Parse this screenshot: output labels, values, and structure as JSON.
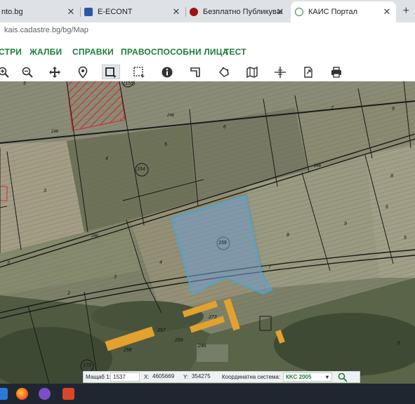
{
  "browser": {
    "tabs": [
      {
        "title": "nto.bg"
      },
      {
        "title": "E-ECONT"
      },
      {
        "title": "Безплатно Публикуване на Об"
      },
      {
        "title": "КАИС Портал"
      }
    ],
    "url": "kais.cadastre.bg/bg/Map"
  },
  "nav": {
    "items": [
      "СТРИ",
      "ЖАЛБИ",
      "СПРАВКИ",
      "ПРАВОСПОСОБНИ ЛИЦА",
      "ТЕСТ"
    ]
  },
  "toolbar": {
    "tools": [
      "zoom-in-icon",
      "zoom-out-icon",
      "pan-icon",
      "locate-pin-icon",
      "select-rectangle-icon",
      "select-area-icon",
      "info-icon",
      "measure-icon",
      "draw-icon",
      "map-layers-icon",
      "crosshair-icon",
      "export-icon",
      "print-icon"
    ],
    "selected": "select-rectangle-icon"
  },
  "map": {
    "plots": [
      {
        "label": "5"
      },
      {
        "label": "(155)"
      },
      {
        "label": "3"
      },
      {
        "label": "4"
      },
      {
        "label": "5"
      },
      {
        "label": "154"
      },
      {
        "label": "6"
      },
      {
        "label": "7"
      },
      {
        "label": "8"
      },
      {
        "label": "9"
      },
      {
        "label": "8"
      },
      {
        "label": "9"
      },
      {
        "label": "6"
      },
      {
        "label": "3"
      },
      {
        "label": "4"
      },
      {
        "label": "2"
      },
      {
        "label": "155"
      },
      {
        "label": "7"
      },
      {
        "label": "3"
      },
      {
        "label": "273"
      },
      {
        "label": "257"
      },
      {
        "label": "258"
      },
      {
        "label": "259"
      },
      {
        "label": "246"
      },
      {
        "label": "173"
      },
      {
        "label": "6"
      },
      {
        "label": "5"
      }
    ],
    "roads": [
      {
        "label": "246"
      },
      {
        "label": "246"
      },
      {
        "label": "246"
      },
      {
        "label": "246"
      }
    ],
    "selected_plot": "155",
    "highlight_color": "#3fa9d8"
  },
  "statusbar": {
    "scale_label": "Мащаб 1:",
    "scale_value": "1537",
    "x_label": "X:",
    "x_value": "4605669",
    "y_label": "Y:",
    "y_value": "354275",
    "crs_label": "Координатна система:",
    "crs_value": "КKC 2005"
  },
  "colors": {
    "nav_green": "#1a7f37"
  }
}
